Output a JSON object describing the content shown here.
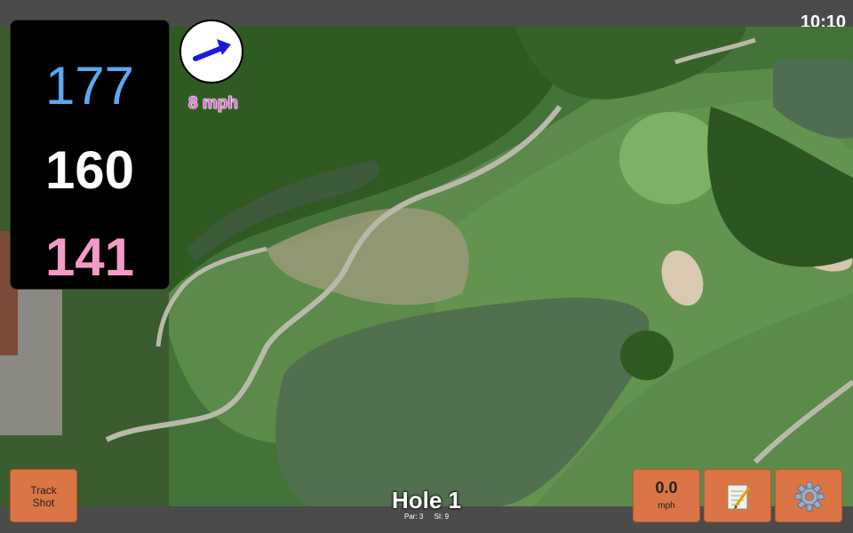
{
  "status": {
    "time": "10:10"
  },
  "distances": {
    "back": "177",
    "middle": "160",
    "front": "141"
  },
  "wind": {
    "speed_text": "8 mph",
    "direction_icon": "wind-arrow-icon"
  },
  "controls": {
    "track_shot_line1": "Track",
    "track_shot_line2": "Shot",
    "speed_value": "0.0",
    "speed_unit": "mph",
    "notes_icon": "notepad-icon",
    "settings_icon": "gear-icon"
  },
  "hole": {
    "title": "Hole 1",
    "par_text": "Par: 3",
    "si_text": "SI: 9"
  },
  "colors": {
    "back_distance": "#5aa9f0",
    "middle_distance": "#ffffff",
    "front_distance": "#f39bc6",
    "wind_text": "#e34fd6",
    "button": "#dc7545",
    "wind_arrow": "#1a1ae0"
  }
}
